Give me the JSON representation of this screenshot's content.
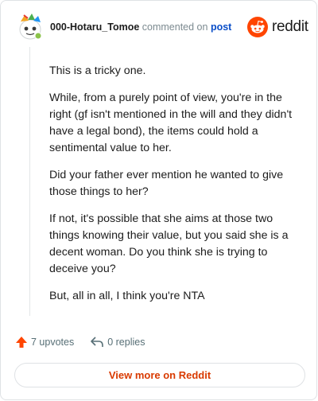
{
  "comment": {
    "username": "000-Hotaru_Tomoe",
    "action_text": "commented on",
    "post_link": "post",
    "paragraphs": [
      "This is a tricky one.",
      "While, from a purely point of view, you're in the right (gf isn't mentioned in the will and they didn't have a legal bond), the items could hold a sentimental value to her.",
      "Did your father ever mention he wanted to give those things to her?",
      "If not, it's possible that she aims at those two things knowing their value, but you said she is a decent woman. Do you think she is trying to deceive you?",
      "But, all in all, I think you're NTA"
    ],
    "upvotes": "7 upvotes",
    "replies": "0 replies"
  },
  "brand": {
    "wordmark": "reddit",
    "color": "#ff4500"
  },
  "footer": {
    "view_more_label": "View more on Reddit"
  },
  "icons": {
    "avatar": "snoo-avatar-icon",
    "brand": "reddit-logo-icon",
    "upvote": "upvote-arrow-icon",
    "reply": "reply-arrow-icon"
  },
  "colors": {
    "accent": "#d93a00",
    "upvote": "#ff4500",
    "link": "#0a4ec8"
  }
}
